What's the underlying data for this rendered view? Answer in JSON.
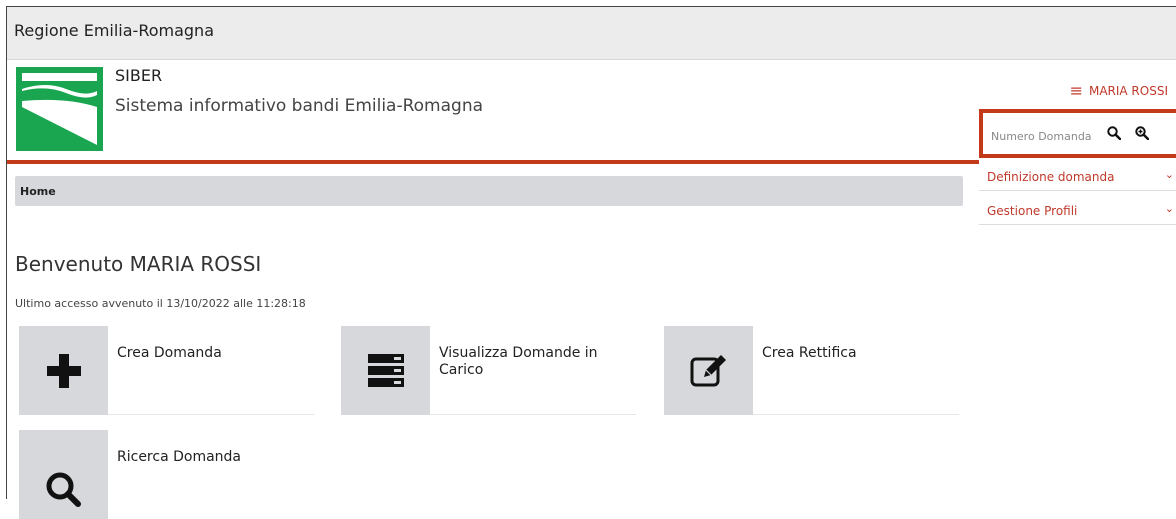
{
  "topbar": {
    "title": "Regione Emilia-Romagna"
  },
  "header": {
    "app_name": "SIBER",
    "app_subtitle": "Sistema informativo bandi Emilia-Romagna",
    "logo_icon": "emilia-romagna-logo",
    "user_name": "MARIA ROSSI",
    "menu_icon": "hamburger-icon"
  },
  "search": {
    "placeholder": "Numero Domanda",
    "search_icon": "search-icon",
    "advanced_search_icon": "zoom-in-icon"
  },
  "sidebar": {
    "items": [
      {
        "label": "Definizione domanda",
        "icon": "chevron-down-icon"
      },
      {
        "label": "Gestione Profili",
        "icon": "chevron-down-icon"
      }
    ]
  },
  "breadcrumb": {
    "home": "Home"
  },
  "main": {
    "welcome": "Benvenuto MARIA ROSSI",
    "last_access": "Ultimo accesso avvenuto il 13/10/2022 alle 11:28:18",
    "tiles": [
      {
        "label": "Crea Domanda",
        "icon": "plus-icon"
      },
      {
        "label": "Visualizza Domande in Carico",
        "icon": "server-list-icon"
      },
      {
        "label": "Crea Rettifica",
        "icon": "edit-icon"
      },
      {
        "label": "Ricerca Domanda",
        "icon": "search-icon"
      }
    ]
  },
  "colors": {
    "accent": "#c33a1b",
    "brand_green": "#1aa650",
    "tile_bg": "#d6d8dc"
  }
}
